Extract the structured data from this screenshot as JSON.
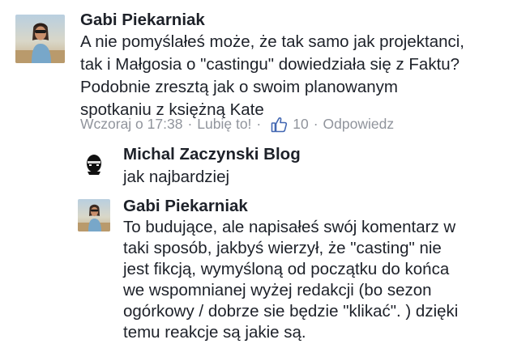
{
  "comment": {
    "author": "Gabi Piekarniak",
    "text_lines": [
      "A nie pomyślałeś może, że tak samo jak projektanci,",
      "tak i Małgosia o \"castingu\" dowiedziała się z Faktu?",
      "Podobnie zresztą jak o swoim planowanym",
      "spotkaniu z księżną Kate"
    ],
    "timestamp": "Wczoraj o 17:38",
    "separator": "·",
    "like_label": "Lubię to!",
    "like_count": "10",
    "reply_label": "Odpowiedz"
  },
  "replies": [
    {
      "author": "Michal Zaczynski Blog",
      "text_lines": [
        "jak najbardziej"
      ]
    },
    {
      "author": "Gabi Piekarniak",
      "text_lines": [
        "To budujące, ale napisałeś swój komentarz w",
        "taki sposób, jakbyś wierzył, że \"casting\" nie",
        "jest fikcją, wymyśloną od początku do końca",
        "we wspomnianej wyżej redakcji (bo sezon",
        "ogórkowy / dobrze sie będzie \"klikać\". ) dzięki",
        "temu reakcje są jakie są."
      ]
    }
  ],
  "colors": {
    "text": "#1d2129",
    "meta": "#90949c",
    "like_icon": "#4267b2"
  },
  "icons": {
    "like": "thumbs-up-icon"
  }
}
